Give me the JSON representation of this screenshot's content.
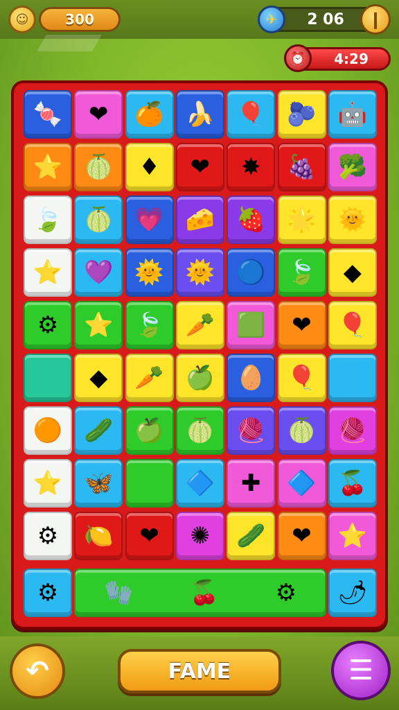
{
  "hud": {
    "score": "300",
    "moves": "2 06",
    "timer": "4:29",
    "pause_icon": "pause-icon",
    "coin_icon": "coin-icon",
    "plane_icon": "plane-icon",
    "clock_icon": "clock-icon"
  },
  "colors": {
    "blue": "#2a5fe0",
    "pink": "#f05ad8",
    "sky": "#2cb8f0",
    "yellow": "#ffe52a",
    "orange": "#ff8a14",
    "red": "#e01818",
    "green": "#2ecb2a",
    "purple": "#8a3ae8",
    "white": "#f4f6f4",
    "teal": "#26c89a",
    "violet": "#6a4ef0",
    "magenta": "#e040e0"
  },
  "board": {
    "rows": [
      [
        [
          "blue",
          "🍬"
        ],
        [
          "pink",
          "❤"
        ],
        [
          "sky",
          "🍊"
        ],
        [
          "blue",
          "🍌"
        ],
        [
          "sky",
          "🎈"
        ],
        [
          "yellow",
          "🫐"
        ],
        [
          "sky",
          "🤖"
        ]
      ],
      [
        [
          "orange",
          "⭐"
        ],
        [
          "orange",
          "🍈"
        ],
        [
          "yellow",
          "♦"
        ],
        [
          "red",
          "❤"
        ],
        [
          "red",
          "✸"
        ],
        [
          "red",
          "🍇"
        ],
        [
          "pink",
          "🥦"
        ]
      ],
      [
        [
          "white",
          "🍃"
        ],
        [
          "sky",
          "🍈"
        ],
        [
          "blue",
          "💗"
        ],
        [
          "purple",
          "🧀"
        ],
        [
          "purple",
          "🍓"
        ],
        [
          "yellow",
          "🌟"
        ],
        [
          "yellow",
          "🌞"
        ]
      ],
      [
        [
          "white",
          "⭐"
        ],
        [
          "sky",
          "💜"
        ],
        [
          "blue",
          "🌞"
        ],
        [
          "violet",
          "🌞"
        ],
        [
          "blue",
          "🔵"
        ],
        [
          "green",
          "🍃"
        ],
        [
          "yellow",
          "◆"
        ]
      ],
      [
        [
          "green",
          "⚙"
        ],
        [
          "green",
          "⭐"
        ],
        [
          "green",
          "🍃"
        ],
        [
          "yellow",
          "🥕"
        ],
        [
          "pink",
          "🟩"
        ],
        [
          "orange",
          "❤"
        ],
        [
          "yellow",
          "🎈"
        ]
      ],
      [
        [
          "teal",
          ""
        ],
        [
          "yellow",
          "◆"
        ],
        [
          "yellow",
          "🥕"
        ],
        [
          "yellow",
          "🍏"
        ],
        [
          "blue",
          "🥚"
        ],
        [
          "yellow",
          "🎈"
        ],
        [
          "sky",
          ""
        ]
      ],
      [
        [
          "white",
          "🟠"
        ],
        [
          "sky",
          "🥒"
        ],
        [
          "green",
          "🍏"
        ],
        [
          "green",
          "🍈"
        ],
        [
          "violet",
          "🧶"
        ],
        [
          "violet",
          "🍈"
        ],
        [
          "magenta",
          "🧶"
        ]
      ],
      [
        [
          "white",
          "⭐"
        ],
        [
          "sky",
          "🦋"
        ],
        [
          "green",
          ""
        ],
        [
          "sky",
          "🔷"
        ],
        [
          "pink",
          "✚"
        ],
        [
          "pink",
          "🔷"
        ],
        [
          "sky",
          "🍒"
        ]
      ],
      [
        [
          "white",
          "⚙"
        ],
        [
          "red",
          "🍋"
        ],
        [
          "red",
          "❤"
        ],
        [
          "magenta",
          "✺"
        ],
        [
          "yellow",
          "🥒"
        ],
        [
          "orange",
          "❤"
        ],
        [
          "pink",
          "⭐"
        ]
      ]
    ],
    "bottom_row": {
      "left": [
        "sky",
        "⚙"
      ],
      "right": [
        "sky",
        "🌶"
      ],
      "middle_color": "green",
      "middle_items": [
        "🧤",
        "🍒",
        "⚙"
      ]
    }
  },
  "footer": {
    "fame_label": "FAME",
    "undo_icon": "undo-icon",
    "menu_icon": "menu-icon"
  }
}
